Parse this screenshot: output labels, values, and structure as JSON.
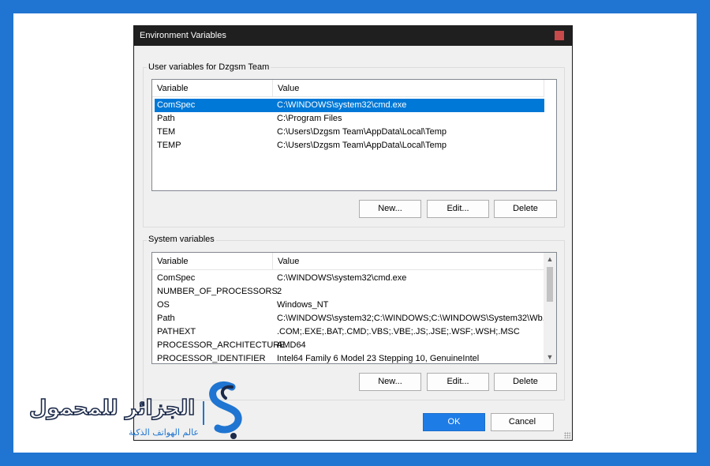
{
  "dialog": {
    "title": "Environment Variables",
    "user_group_label": "User variables for Dzgsm Team",
    "system_group_label": "System variables",
    "ok_label": "OK",
    "cancel_label": "Cancel"
  },
  "user_list": {
    "columns": [
      "Variable",
      "Value"
    ],
    "rows": [
      {
        "variable": "ComSpec",
        "value": "C:\\WINDOWS\\system32\\cmd.exe",
        "selected": true
      },
      {
        "variable": "Path",
        "value": "C:\\Program Files"
      },
      {
        "variable": "TEM",
        "value": "C:\\Users\\Dzgsm Team\\AppData\\Local\\Temp"
      },
      {
        "variable": "TEMP",
        "value": "C:\\Users\\Dzgsm Team\\AppData\\Local\\Temp"
      }
    ],
    "buttons": [
      "New...",
      "Edit...",
      "Delete"
    ]
  },
  "system_list": {
    "columns": [
      "Variable",
      "Value"
    ],
    "rows": [
      {
        "variable": "ComSpec",
        "value": "C:\\WINDOWS\\system32\\cmd.exe"
      },
      {
        "variable": "NUMBER_OF_PROCESSORS",
        "value": "2"
      },
      {
        "variable": "OS",
        "value": "Windows_NT"
      },
      {
        "variable": "Path",
        "value": "C:\\WINDOWS\\system32;C:\\WINDOWS;C:\\WINDOWS\\System32\\Wb..."
      },
      {
        "variable": "PATHEXT",
        "value": ".COM;.EXE;.BAT;.CMD;.VBS;.VBE;.JS;.JSE;.WSF;.WSH;.MSC"
      },
      {
        "variable": "PROCESSOR_ARCHITECTURE",
        "value": "AMD64"
      },
      {
        "variable": "PROCESSOR_IDENTIFIER",
        "value": "Intel64 Family 6 Model 23 Stepping 10, GenuineIntel"
      }
    ],
    "buttons": [
      "New...",
      "Edit...",
      "Delete"
    ]
  },
  "watermark": {
    "brand_text": "الجزائر للمحمول",
    "tagline": "عالم الهواتف الذكية"
  },
  "colors": {
    "frame": "#1f75d1",
    "selection": "#0078d7",
    "logo_blue": "#1f75d1",
    "logo_dark": "#1c2a4a"
  }
}
